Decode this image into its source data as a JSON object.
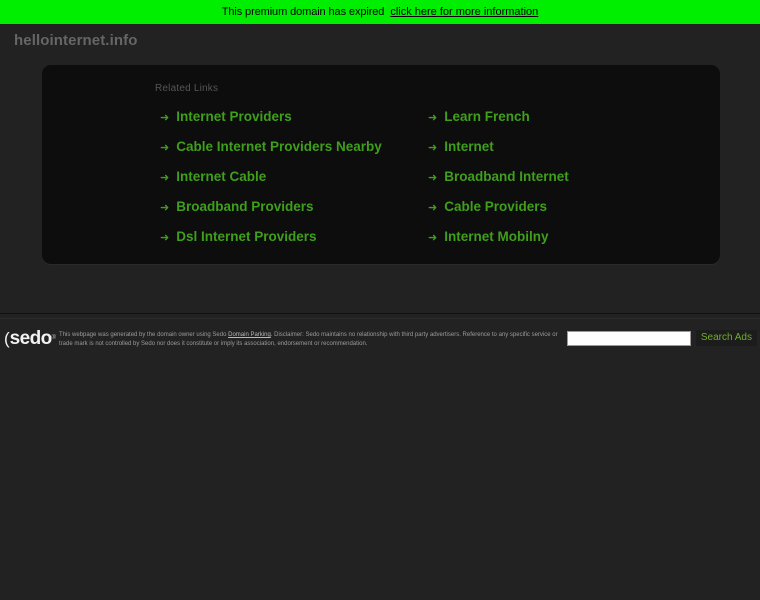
{
  "banner": {
    "message": "This premium domain has expired",
    "link_label": "click here for more information",
    "background_color": "#00ee00",
    "text_color": "#000000"
  },
  "header": {
    "domain": "hellointernet.info"
  },
  "panel": {
    "heading": "Related Links",
    "accent_color": "#3f9f1b",
    "background_color": "#0d0d0d",
    "arrow_icon": "➜",
    "links_left": [
      {
        "label": "Internet Providers"
      },
      {
        "label": "Cable Internet Providers Nearby"
      },
      {
        "label": "Internet Cable"
      },
      {
        "label": "Broadband Providers"
      },
      {
        "label": "Dsl Internet Providers"
      }
    ],
    "links_right": [
      {
        "label": "Learn French"
      },
      {
        "label": "Internet"
      },
      {
        "label": "Broadband Internet"
      },
      {
        "label": "Cable Providers"
      },
      {
        "label": "Internet Mobilny"
      }
    ]
  },
  "footer": {
    "logo_text": "sedo",
    "logo_paren": "(",
    "logo_registered": "®",
    "disclaimer_part1": "This webpage was generated by the domain owner using Sedo ",
    "disclaimer_link": "Domain Parking",
    "disclaimer_part2": ". Disclaimer: Sedo maintains no relationship with third party advertisers. Reference to any specific service or trade mark is not controlled by Sedo nor does it constitute or imply its association, endorsement or recommendation.",
    "search_value": "",
    "search_placeholder": "",
    "search_button_label": "Search Ads"
  }
}
